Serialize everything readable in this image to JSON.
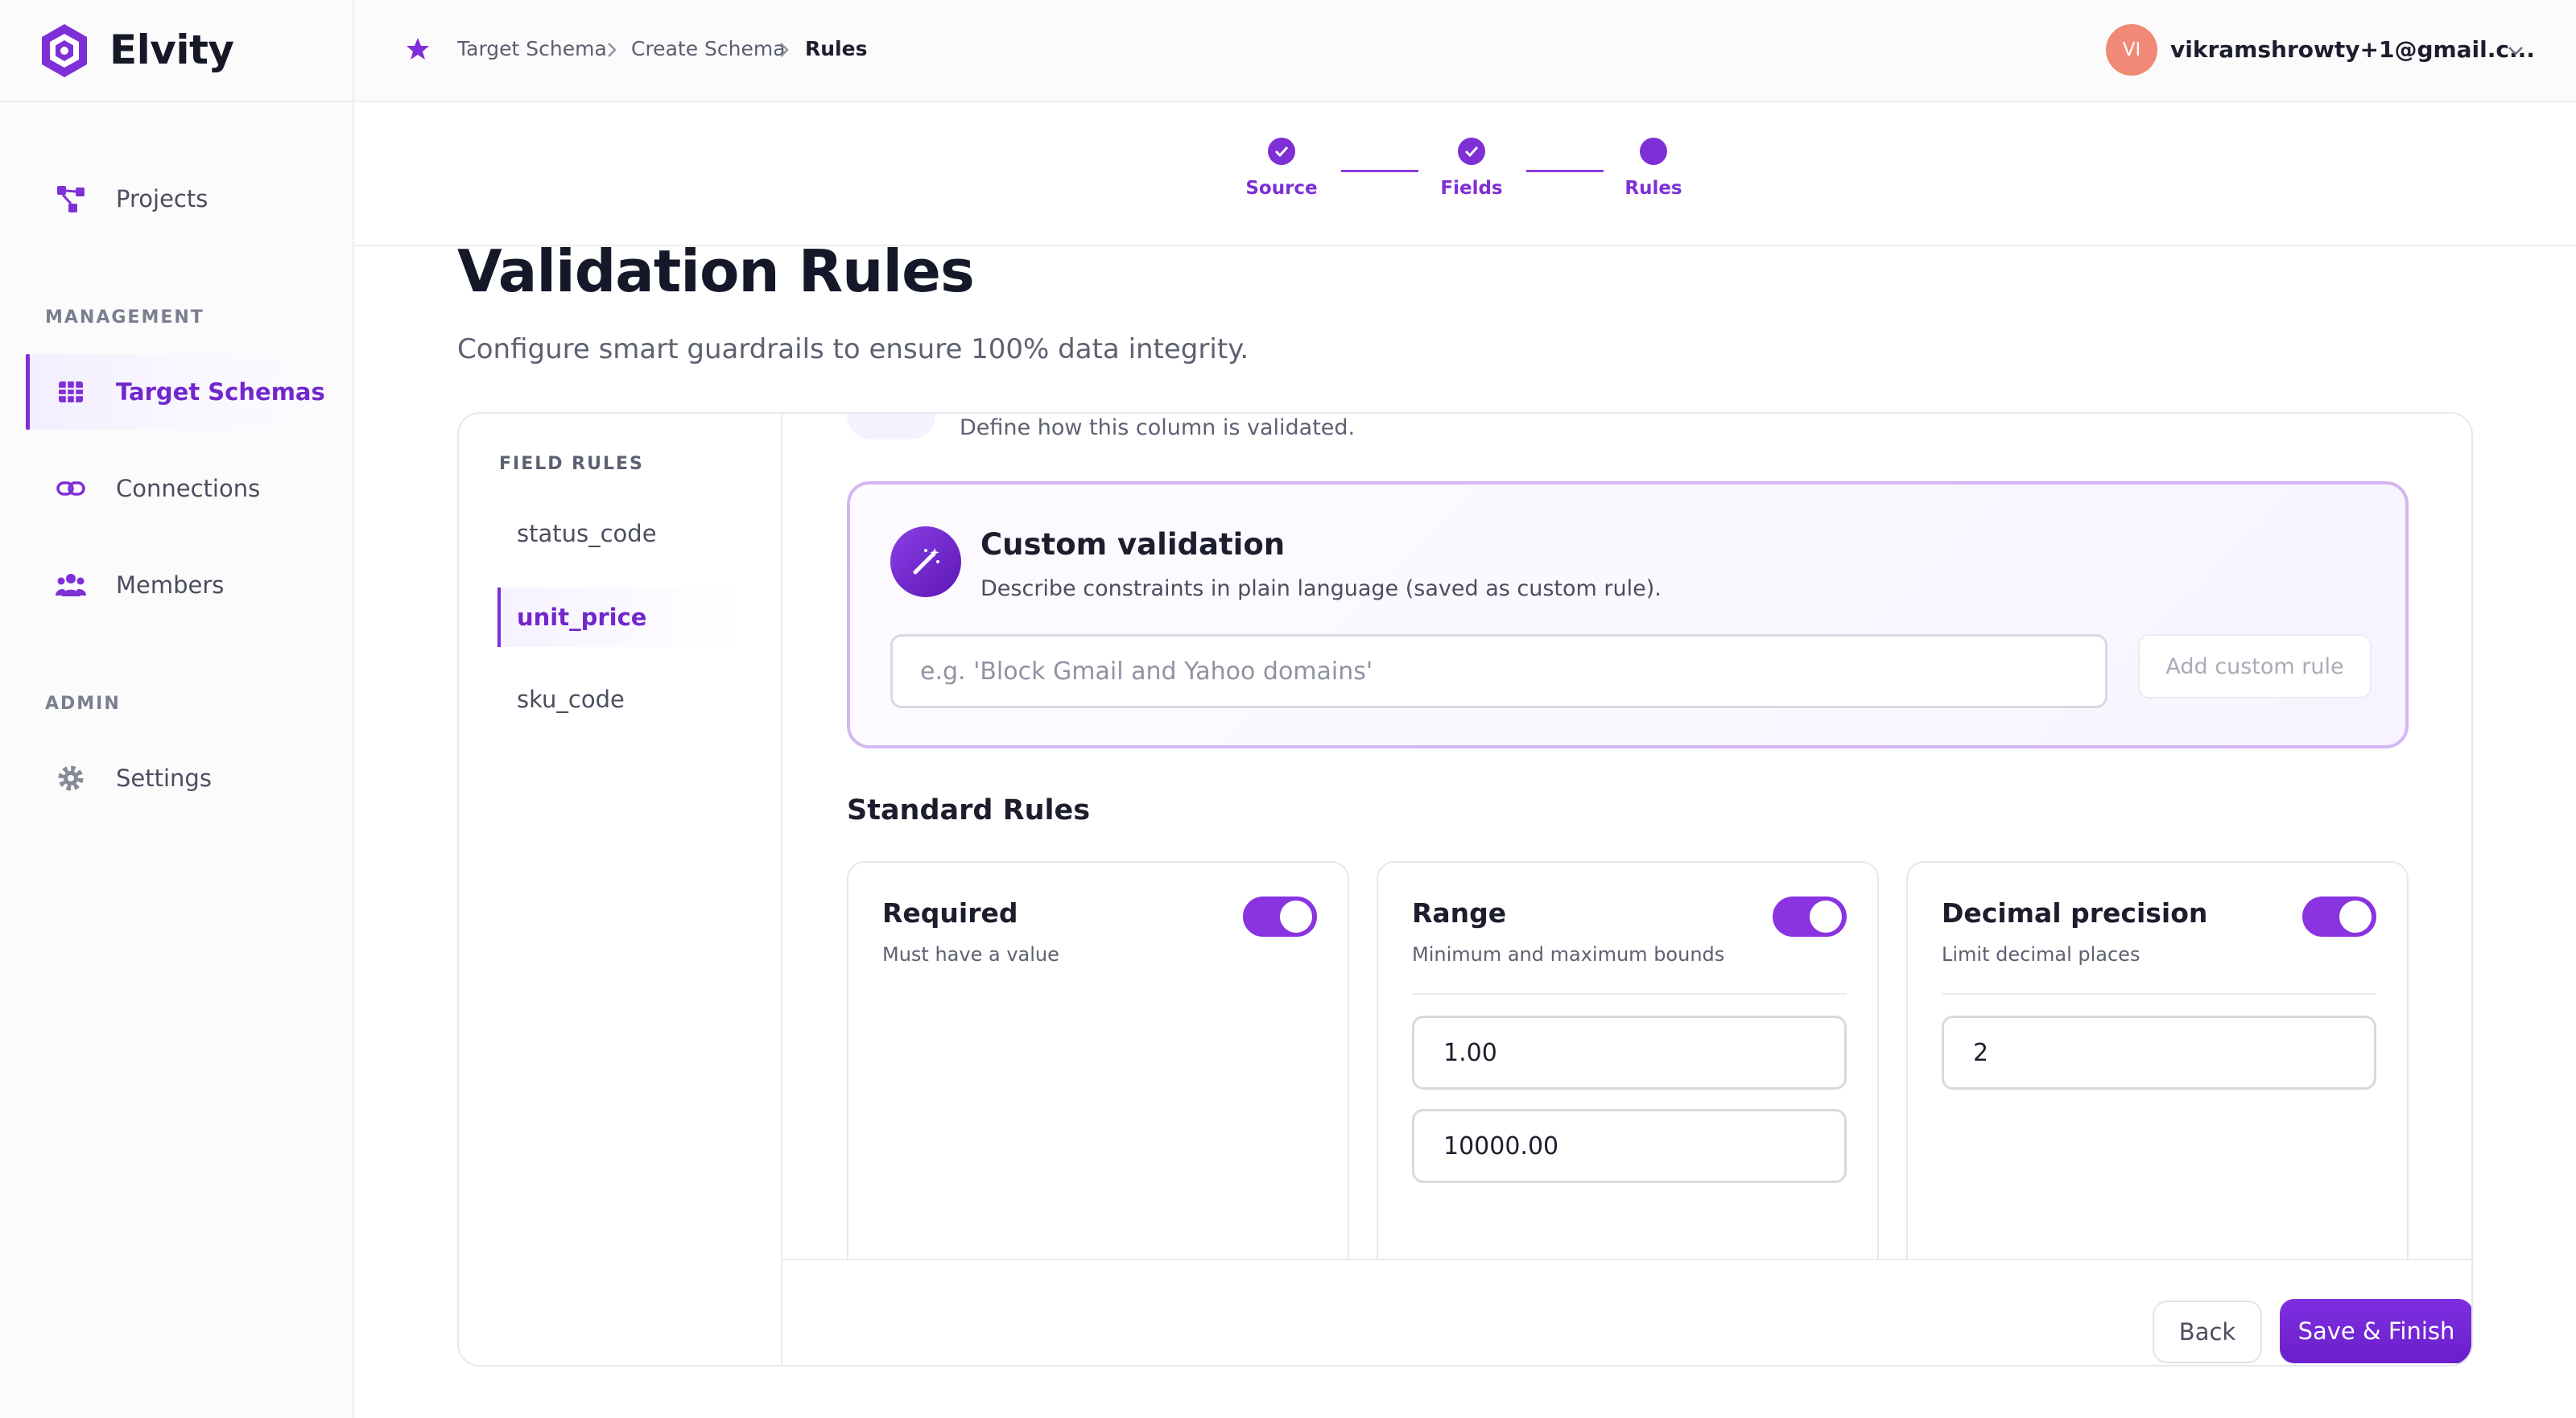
{
  "app": {
    "name": "Elvity"
  },
  "sidebar": {
    "items": [
      {
        "label": "Projects"
      },
      {
        "label": "Target Schemas"
      },
      {
        "label": "Connections"
      },
      {
        "label": "Members"
      },
      {
        "label": "Settings"
      }
    ],
    "sections": {
      "management": "MANAGEMENT",
      "admin": "ADMIN"
    }
  },
  "breadcrumb": [
    "Target Schema",
    "Create Schema",
    "Rules"
  ],
  "user": {
    "initials": "VI",
    "email": "vikramshrowty+1@gmail.c..."
  },
  "stepper": {
    "steps": [
      {
        "label": "Source",
        "status": "complete"
      },
      {
        "label": "Fields",
        "status": "complete"
      },
      {
        "label": "Rules",
        "status": "current"
      }
    ]
  },
  "page": {
    "title": "Validation Rules",
    "subtitle": "Configure smart guardrails to ensure 100% data integrity."
  },
  "field_rules": {
    "title": "FIELD RULES",
    "items": [
      {
        "label": "status_code"
      },
      {
        "label": "unit_price"
      },
      {
        "label": "sku_code"
      }
    ],
    "selected": "unit_price"
  },
  "rule_area": {
    "hint": "Define how this column is validated."
  },
  "custom_validation": {
    "title": "Custom validation",
    "description": "Describe constraints in plain language (saved as custom rule).",
    "input_value": "",
    "placeholder": "e.g. 'Block Gmail and Yahoo domains'",
    "button_label": "Add custom rule"
  },
  "standard_rules": {
    "title": "Standard Rules",
    "rules": [
      {
        "title": "Required",
        "description": "Must have a value",
        "enabled": true
      },
      {
        "title": "Range",
        "description": "Minimum and maximum bounds",
        "enabled": true,
        "min": "1.00",
        "max": "10000.00"
      },
      {
        "title": "Decimal precision",
        "description": "Limit decimal places",
        "enabled": true,
        "value": "2"
      }
    ]
  },
  "actions": {
    "back_label": "Back",
    "save_label": "Save & Finish"
  },
  "colors": {
    "accent": "#7e2fd6",
    "avatar": "#f08a76",
    "toggle_on": "#8a33e0"
  }
}
